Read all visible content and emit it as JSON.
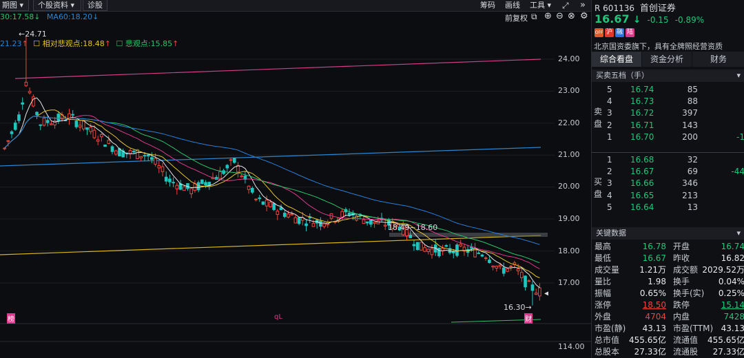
{
  "toolbar": {
    "period_btn": "期图",
    "stock_info_btn": "个股资料",
    "diagnose_btn": "诊股",
    "chip_link": "筹码",
    "draw_link": "画线",
    "tools_link": "工具",
    "restore_link": "前复权",
    "more_icon": "»"
  },
  "ma_line": {
    "ma30": "30:17.58",
    "ma60": "MA60:18.20",
    "indicator_value": "21.23",
    "rel_pessimist": "相对悲观点:18.48",
    "pessimist": "悲观点:15.85"
  },
  "annotations": {
    "high_label": "←24.71",
    "mid_label": "18.49~18.60",
    "low_label": "16.30→",
    "finance_mark": "财",
    "left_mark": "榜",
    "mid_mark": "qL"
  },
  "y_axis": [
    "24.00",
    "23.00",
    "22.00",
    "21.00",
    "20.00",
    "19.00",
    "18.00",
    "17.00",
    "114.00"
  ],
  "chart_data": {
    "type": "candlestick",
    "title": "",
    "y_ticks": [
      24,
      23,
      22,
      21,
      20,
      19,
      18,
      17
    ],
    "ylim": [
      16.2,
      24.9
    ],
    "last_price": 16.67,
    "high": 24.71,
    "low": 16.3,
    "series": [
      {
        "name": "MA30",
        "values": [
          17.58
        ]
      },
      {
        "name": "MA60",
        "values": [
          18.2
        ]
      }
    ]
  },
  "stock": {
    "prefix": "R",
    "code": "601136",
    "name": "首创证券",
    "price": "16.67",
    "arrow": "↓",
    "change": "-0.15",
    "change_pct": "-0.89%",
    "badges": [
      "OFF",
      "沪",
      "融",
      "陆"
    ],
    "desc": "北京国资委旗下，具有全牌照经营资质"
  },
  "tabs": [
    "综合看盘",
    "资金分析",
    "财务"
  ],
  "orderbook": {
    "title": "买卖五档（手）",
    "sell_label": "卖盘",
    "buy_label": "买盘",
    "sell": [
      {
        "lvl": "5",
        "price": "16.74",
        "vol": "85",
        "extra": ""
      },
      {
        "lvl": "4",
        "price": "16.73",
        "vol": "88",
        "extra": ""
      },
      {
        "lvl": "3",
        "price": "16.72",
        "vol": "397",
        "extra": ""
      },
      {
        "lvl": "2",
        "price": "16.71",
        "vol": "143",
        "extra": ""
      },
      {
        "lvl": "1",
        "price": "16.70",
        "vol": "200",
        "extra": "-1"
      }
    ],
    "buy": [
      {
        "lvl": "1",
        "price": "16.68",
        "vol": "32",
        "extra": ""
      },
      {
        "lvl": "2",
        "price": "16.67",
        "vol": "69",
        "extra": "-44"
      },
      {
        "lvl": "3",
        "price": "16.66",
        "vol": "346",
        "extra": ""
      },
      {
        "lvl": "4",
        "price": "16.65",
        "vol": "213",
        "extra": ""
      },
      {
        "lvl": "5",
        "price": "16.64",
        "vol": "13",
        "extra": ""
      }
    ]
  },
  "key_data": {
    "title": "关键数据",
    "rows": [
      {
        "l1": "最高",
        "v1": "16.78",
        "l2": "开盘",
        "v2": "16.74"
      },
      {
        "l1": "最低",
        "v1": "16.67",
        "l2": "昨收",
        "v2": "16.82"
      },
      {
        "l1": "成交量",
        "v1": "1.21万",
        "l2": "成交额",
        "v2": "2029.52万"
      },
      {
        "l1": "量比",
        "v1": "1.98",
        "l2": "换手",
        "v2": "0.04%"
      },
      {
        "l1": "振幅",
        "v1": "0.65%",
        "l2": "换手(实)",
        "v2": "0.25%"
      },
      {
        "l1": "涨停",
        "v1": "18.50",
        "l2": "跌停",
        "v2": "15.14"
      },
      {
        "l1": "外盘",
        "v1": "4704",
        "l2": "内盘",
        "v2": "7428"
      },
      {
        "l1": "市盈(静)",
        "v1": "43.13",
        "l2": "市盈(TTM)",
        "v2": "43.13"
      },
      {
        "l1": "总市值",
        "v1": "455.65亿",
        "l2": "流通值",
        "v2": "455.65亿"
      },
      {
        "l1": "总股本",
        "v1": "27.33亿",
        "l2": "流通股",
        "v2": "27.33亿"
      }
    ]
  },
  "colors": {
    "up": "#f0463a",
    "down": "#1fc6c0",
    "green": "#1fc77b",
    "ma5": "#e8e8e8",
    "ma10": "#e6c229",
    "ma20": "#e0388c",
    "ma30": "#2ec26a",
    "ma60": "#2a7fd8",
    "trend_pink": "#d23d8a",
    "trend_blue": "#2a86d0",
    "trend_yellow": "#d9b51c"
  }
}
